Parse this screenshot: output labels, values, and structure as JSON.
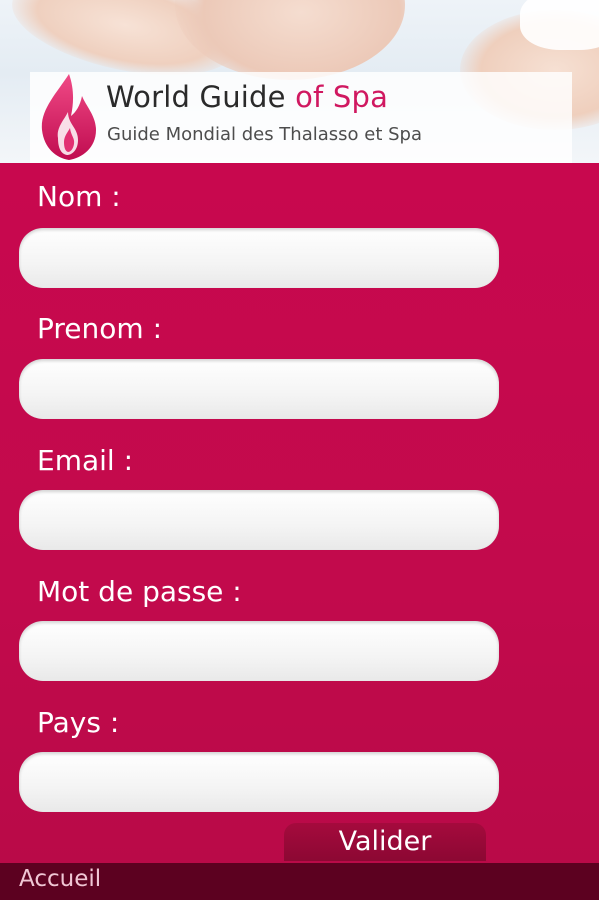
{
  "header": {
    "brand_main": "World Guide",
    "brand_accent": "of Spa",
    "tagline": "Guide Mondial des Thalasso et Spa"
  },
  "form": {
    "fields": [
      {
        "label": "Nom :",
        "value": ""
      },
      {
        "label": "Prenom :",
        "value": ""
      },
      {
        "label": "Email :",
        "value": ""
      },
      {
        "label": "Mot de passe :",
        "value": ""
      },
      {
        "label": "Pays :",
        "value": ""
      }
    ],
    "submit_label": "Valider"
  },
  "footer": {
    "home_label": "Accueil"
  },
  "colors": {
    "background": "#c30b4e",
    "footer": "#5c0120",
    "brand_accent": "#d01860",
    "button": "#8c0833"
  },
  "icons": {
    "logo": "flame-logo-icon"
  }
}
